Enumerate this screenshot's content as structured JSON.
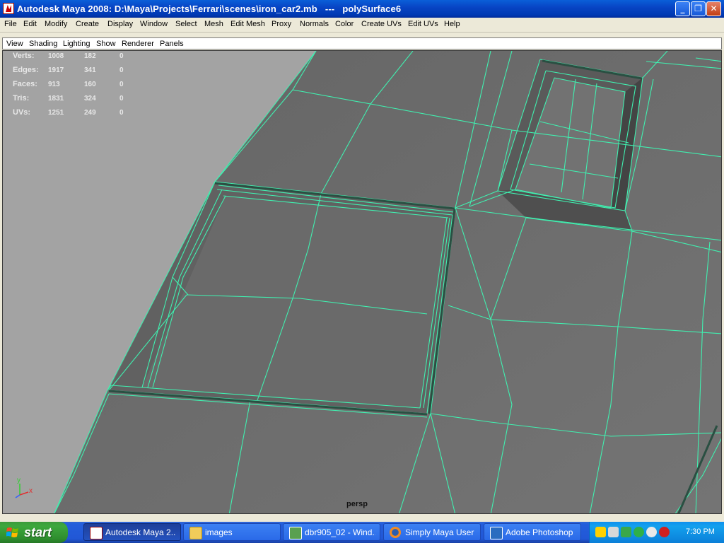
{
  "window": {
    "title": "Autodesk Maya 2008: D:\\Maya\\Projects\\Ferrari\\scenes\\iron_car2.mb   ---   polySurface6",
    "minimize_glyph": "_",
    "maximize_glyph": "❐",
    "close_glyph": "✕"
  },
  "menubar": [
    "File",
    "Edit",
    "Modify",
    "Create",
    "Display",
    "Window",
    "Select",
    "Mesh",
    "Edit Mesh",
    "Proxy",
    "Normals",
    "Color",
    "Create UVs",
    "Edit UVs",
    "Help"
  ],
  "panel_menu": [
    "View",
    "Shading",
    "Lighting",
    "Show",
    "Renderer",
    "Panels"
  ],
  "hud": {
    "rows": [
      {
        "label": "Verts:",
        "values": [
          "1008",
          "182",
          "0"
        ]
      },
      {
        "label": "Edges:",
        "values": [
          "1917",
          "341",
          "0"
        ]
      },
      {
        "label": "Faces:",
        "values": [
          "913",
          "160",
          "0"
        ]
      },
      {
        "label": "Tris:",
        "values": [
          "1831",
          "324",
          "0"
        ]
      },
      {
        "label": "UVs:",
        "values": [
          "1251",
          "249",
          "0"
        ]
      }
    ]
  },
  "viewport": {
    "camera_label": "persp",
    "axis_y": "y",
    "axis_x": "x",
    "colors": {
      "background": "#a3a3a3",
      "mesh_face": "#6b6b6b",
      "wireframe": "#40f0b0",
      "axis_x": "#e03030",
      "axis_y": "#30d030"
    }
  },
  "taskbar": {
    "start_label": "start",
    "tasks": [
      {
        "label": "Autodesk Maya 2...",
        "icon": "maya-icon",
        "active": true
      },
      {
        "label": "images",
        "icon": "folder-icon",
        "active": false
      },
      {
        "label": "dbr905_02 - Wind...",
        "icon": "picture-viewer-icon",
        "active": false
      },
      {
        "label": "Simply Maya User ...",
        "icon": "firefox-icon",
        "active": false
      },
      {
        "label": "Adobe Photoshop",
        "icon": "photoshop-icon",
        "active": false
      }
    ],
    "tray_icons": [
      "shield-icon",
      "network-icon",
      "safely-remove-icon",
      "sync-icon",
      "messenger-icon",
      "security-alert-icon"
    ],
    "clock": "7:30 PM"
  }
}
